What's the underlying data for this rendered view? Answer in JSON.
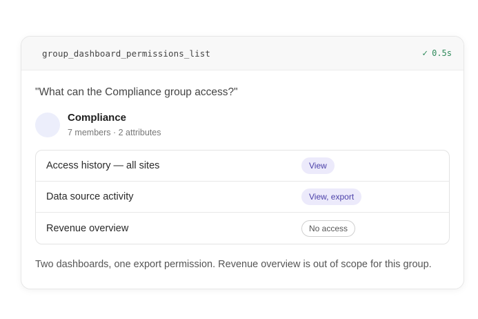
{
  "tool_call": {
    "function_name": "group_dashboard_permissions_list",
    "status_icon": "check-icon",
    "duration": "0.5s",
    "status_color": "#2f8a5b"
  },
  "query": "\"What can the Compliance group access?\"",
  "group": {
    "name": "Compliance",
    "meta": "7 members · 2 attributes",
    "avatar_color": "#eceefb"
  },
  "permissions": [
    {
      "dashboard": "Access history — all sites",
      "access": "View",
      "state": "allowed"
    },
    {
      "dashboard": "Data source activity",
      "access": "View, export",
      "state": "allowed"
    },
    {
      "dashboard": "Revenue overview",
      "access": "No access",
      "state": "denied"
    }
  ],
  "summary": "Two dashboards, one export permission. Revenue overview is out of scope for this group.",
  "colors": {
    "badge_allowed_bg": "#eceafb",
    "badge_allowed_text": "#4a3fa8",
    "badge_denied_border": "#cfcfcf"
  }
}
